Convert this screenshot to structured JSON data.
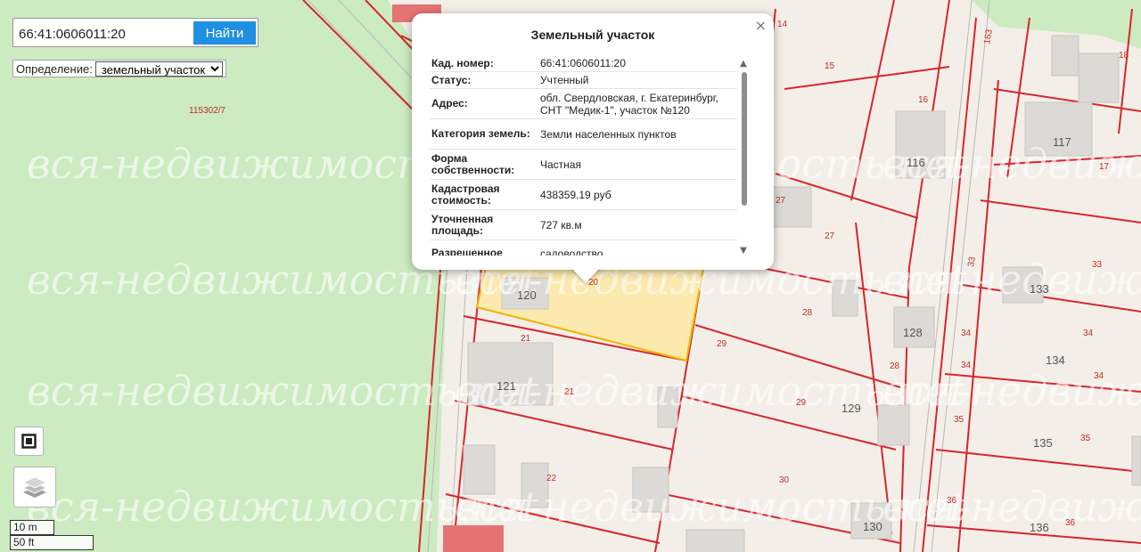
{
  "search": {
    "value": "66:41:0606011:20",
    "button": "Найти"
  },
  "definition": {
    "label": "Определение:",
    "selected": "земельный участок"
  },
  "popup": {
    "title": "Земельный участок",
    "close": "×",
    "rows": [
      {
        "key": "Кад. номер:",
        "value": "66:41:0606011:20"
      },
      {
        "key": "Статус:",
        "value": "Учтенный"
      },
      {
        "key": "Адрес:",
        "value": "обл. Свердловская, г. Екатеринбург, СНТ \"Медик-1\", участок №120"
      },
      {
        "key": "Категория земель:",
        "value": "Земли населенных пунктов"
      },
      {
        "key": "Форма собственности:",
        "value": "Частная"
      },
      {
        "key": "Кадастровая стоимость:",
        "value": "438359.19 руб"
      },
      {
        "key": "Уточненная площадь:",
        "value": "727 кв.м"
      },
      {
        "key": "Разрешенное",
        "value": "садоводство"
      }
    ]
  },
  "scale": {
    "metric": "10 m",
    "imperial": "50 ft"
  },
  "watermark": "вся-недвижимость.net",
  "map_labels": {
    "parcel_code": "115302/7",
    "selected_parcel": "20",
    "parcel_numbers": [
      "14",
      "15",
      "16",
      "18",
      "163",
      "17",
      "27",
      "27",
      "33",
      "33",
      "28",
      "34",
      "34",
      "34",
      "34",
      "28",
      "29",
      "29",
      "21",
      "21",
      "22",
      "35",
      "35",
      "30",
      "36",
      "36"
    ],
    "house_numbers": [
      "120",
      "121",
      "116",
      "117",
      "133",
      "128",
      "134",
      "129",
      "135",
      "130",
      "136"
    ]
  },
  "colors": {
    "parcel_border": "#d8252e",
    "selected_fill": "#fce8a6",
    "selected_border": "#f0b400",
    "green_area": "#ccebc0",
    "map_bg": "#f3efe8",
    "button": "#1f8fe0"
  }
}
